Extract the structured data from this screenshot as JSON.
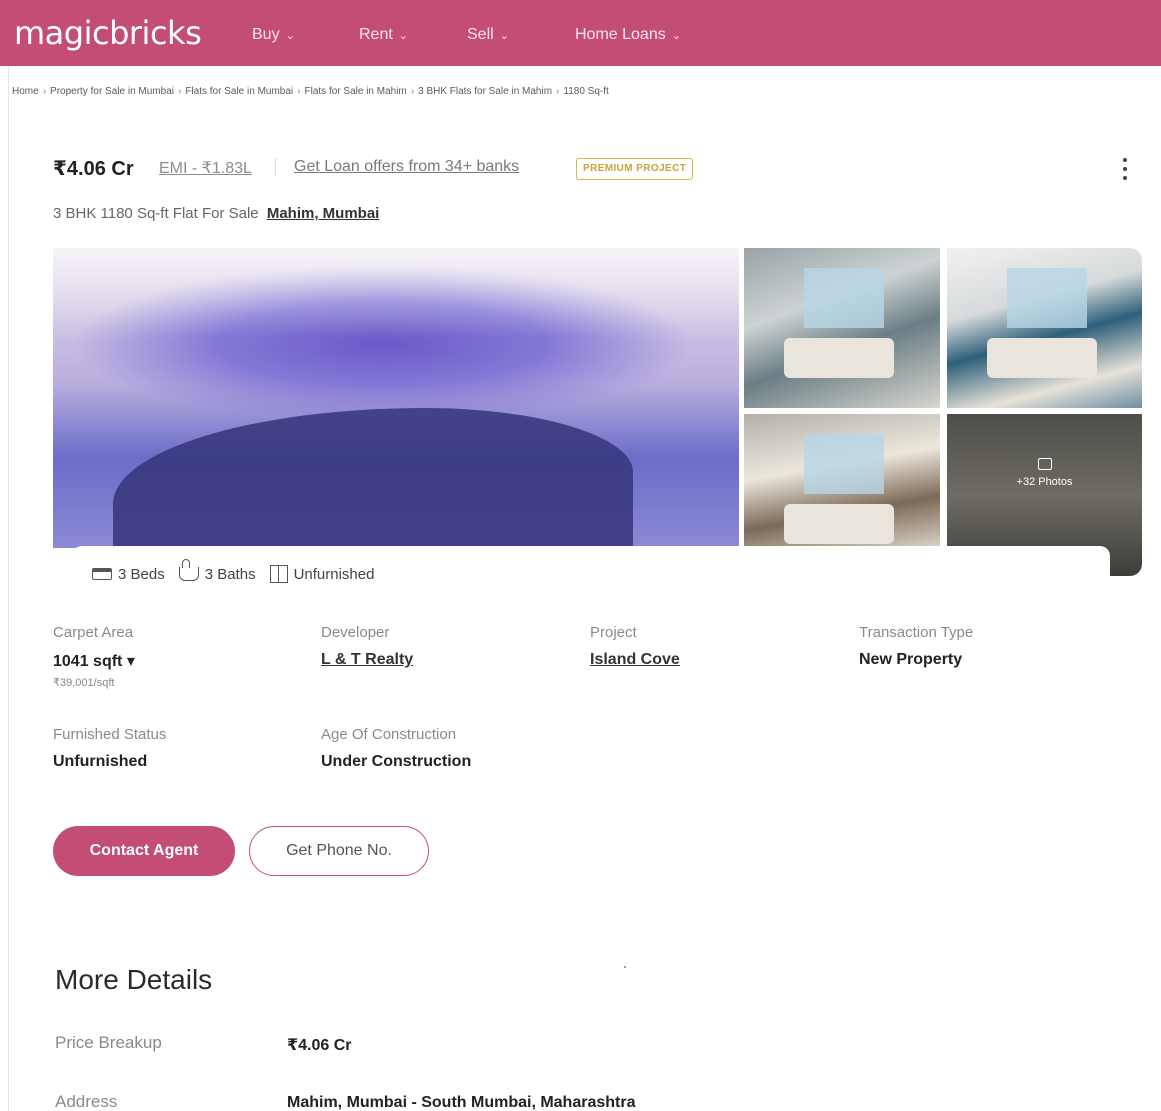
{
  "header": {
    "logo": "magicbricks",
    "nav": [
      {
        "label": "Buy"
      },
      {
        "label": "Rent"
      },
      {
        "label": "Sell"
      },
      {
        "label": "Home Loans"
      }
    ],
    "chevron": "⌄"
  },
  "breadcrumb": [
    "Home",
    "Property for Sale in Mumbai",
    "Flats for Sale in Mumbai",
    "Flats for Sale in Mahim",
    "3 BHK Flats for Sale in Mahim",
    "1180 Sq-ft"
  ],
  "breadcrumb_sep": "›",
  "listing": {
    "price": "₹4.06 Cr",
    "emi": "EMI - ₹1.83L",
    "loan_offer": "Get Loan offers from 34+ banks",
    "badge": "PREMIUM PROJECT",
    "title": "3 BHK 1180 Sq-ft Flat For Sale",
    "location": "Mahim, Mumbai"
  },
  "gallery": {
    "more_photos": "+32 Photos"
  },
  "features": {
    "beds": "3 Beds",
    "baths": "3 Baths",
    "furnishing": "Unfurnished"
  },
  "summary": {
    "carpet_area_label": "Carpet Area",
    "carpet_area_value": "1041 sqft ▾",
    "carpet_area_rate": "₹39,001/sqft",
    "developer_label": "Developer",
    "developer_value": "L & T Realty",
    "project_label": "Project",
    "project_value": "Island Cove",
    "transaction_label": "Transaction Type",
    "transaction_value": "New Property",
    "furnished_label": "Furnished Status",
    "furnished_value": "Unfurnished",
    "age_label": "Age Of Construction",
    "age_value": "Under Construction"
  },
  "actions": {
    "contact": "Contact Agent",
    "phone": "Get Phone No."
  },
  "more_details": {
    "title": "More Details",
    "rows": [
      {
        "label": "Price Breakup",
        "value": "₹4.06 Cr"
      },
      {
        "label": "Address",
        "value": "Mahim, Mumbai - South Mumbai, Maharashtra"
      }
    ]
  },
  "colors": {
    "brand": "#c44d78",
    "premium": "#c9a43a"
  }
}
